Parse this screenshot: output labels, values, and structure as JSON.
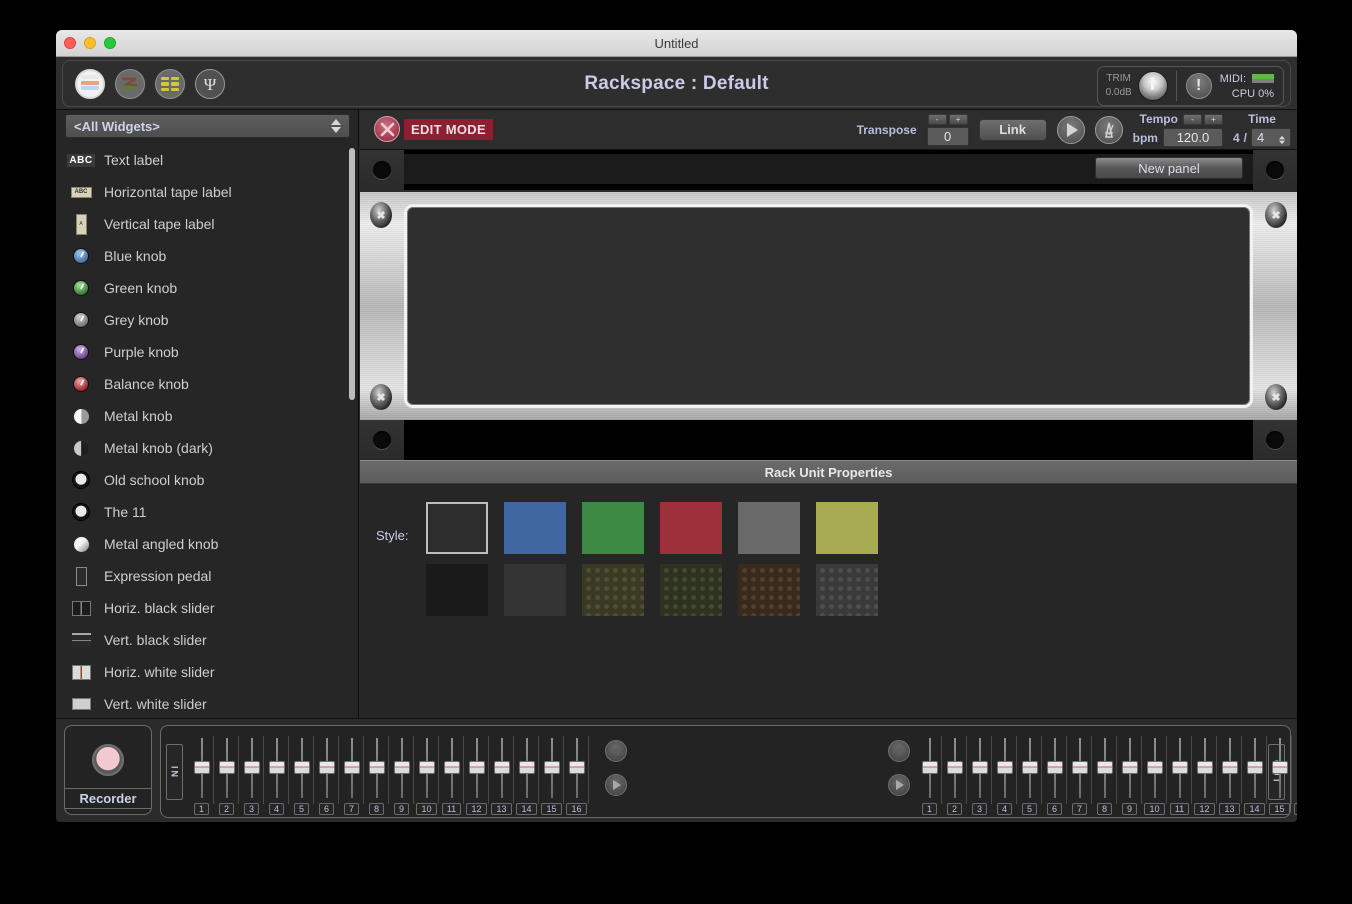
{
  "window": {
    "title": "Untitled"
  },
  "header": {
    "app_title": "Rackspace : Default",
    "icons": [
      {
        "name": "rack-view-icon",
        "selected": true
      },
      {
        "name": "wiring-view-icon",
        "selected": false
      },
      {
        "name": "grid-view-icon",
        "selected": false
      },
      {
        "name": "tuner-icon",
        "selected": false
      }
    ],
    "trim_label": "TRIM",
    "trim_value": "0.0dB",
    "trim_knob": "trim-knob",
    "alert_icon": "exclamation-icon",
    "midi_label": "MIDI:",
    "cpu_label": "CPU",
    "cpu_value": "0%"
  },
  "sidebar": {
    "filter_value": "<All Widgets>",
    "items": [
      {
        "label": "Text label",
        "icon": "text-label-icon"
      },
      {
        "label": "Horizontal tape label",
        "icon": "horizontal-tape-label-icon"
      },
      {
        "label": "Vertical tape label",
        "icon": "vertical-tape-label-icon"
      },
      {
        "label": "Blue knob",
        "icon": "blue-knob-icon"
      },
      {
        "label": "Green knob",
        "icon": "green-knob-icon"
      },
      {
        "label": "Grey knob",
        "icon": "grey-knob-icon"
      },
      {
        "label": "Purple knob",
        "icon": "purple-knob-icon"
      },
      {
        "label": "Balance knob",
        "icon": "balance-knob-icon"
      },
      {
        "label": "Metal knob",
        "icon": "metal-knob-icon"
      },
      {
        "label": "Metal knob (dark)",
        "icon": "metal-knob-dark-icon"
      },
      {
        "label": "Old school knob",
        "icon": "old-school-knob-icon"
      },
      {
        "label": "The 11",
        "icon": "the-11-knob-icon"
      },
      {
        "label": "Metal angled knob",
        "icon": "metal-angled-knob-icon"
      },
      {
        "label": "Expression pedal",
        "icon": "expression-pedal-icon"
      },
      {
        "label": "Horiz. black slider",
        "icon": "horiz-black-slider-icon"
      },
      {
        "label": "Vert. black slider",
        "icon": "vert-black-slider-icon"
      },
      {
        "label": "Horiz. white slider",
        "icon": "horiz-white-slider-icon"
      },
      {
        "label": "Vert. white slider",
        "icon": "vert-white-slider-icon"
      }
    ]
  },
  "edit_bar": {
    "edit_mode_label": "EDIT MODE",
    "transpose_label": "Transpose",
    "transpose_value": "0",
    "minus_label": "-",
    "plus_label": "+",
    "link_label": "Link",
    "play_icon": "play-icon",
    "metronome_icon": "metronome-icon",
    "tempo_label_1": "Tempo",
    "tempo_label_2": "bpm",
    "tempo_value": "120.0",
    "time_label": "Time",
    "time_numerator": "4",
    "time_slash": "/",
    "time_denominator": "4"
  },
  "rack": {
    "new_panel_label": "New panel",
    "screw_glyph": "✖"
  },
  "properties": {
    "title": "Rack Unit Properties",
    "style_label": "Style:",
    "styles_row1": [
      {
        "name": "style-plain-dark",
        "color": "#2d2d2d",
        "selected": true
      },
      {
        "name": "style-blue",
        "color": "#40679f",
        "selected": false
      },
      {
        "name": "style-green",
        "color": "#3c8a43",
        "selected": false
      },
      {
        "name": "style-red",
        "color": "#9e303c",
        "selected": false
      },
      {
        "name": "style-grey",
        "color": "#696969",
        "selected": false
      },
      {
        "name": "style-olive",
        "color": "#a9ab52",
        "selected": false
      }
    ],
    "styles_row2": [
      {
        "name": "style-black-scuffed",
        "color": "#1a1a1a",
        "selected": false
      },
      {
        "name": "style-charcoal",
        "color": "#343434",
        "selected": false
      },
      {
        "name": "style-olive-dots",
        "color": "#3a3a22",
        "selected": false
      },
      {
        "name": "style-green-dots",
        "color": "#2e3320",
        "selected": false
      },
      {
        "name": "style-brown-dots",
        "color": "#3a2a1c",
        "selected": false
      },
      {
        "name": "style-grey-dots",
        "color": "#3a3a3a",
        "selected": false
      }
    ]
  },
  "mixer": {
    "recorder_label": "Recorder",
    "in_label": "IN",
    "out_label": "OUT",
    "channel_numbers": [
      "1",
      "2",
      "3",
      "4",
      "5",
      "6",
      "7",
      "8",
      "9",
      "10",
      "11",
      "12",
      "13",
      "14",
      "15",
      "16"
    ],
    "prev_icon": "arrow-left-icon",
    "next_icon": "arrow-right-icon"
  }
}
